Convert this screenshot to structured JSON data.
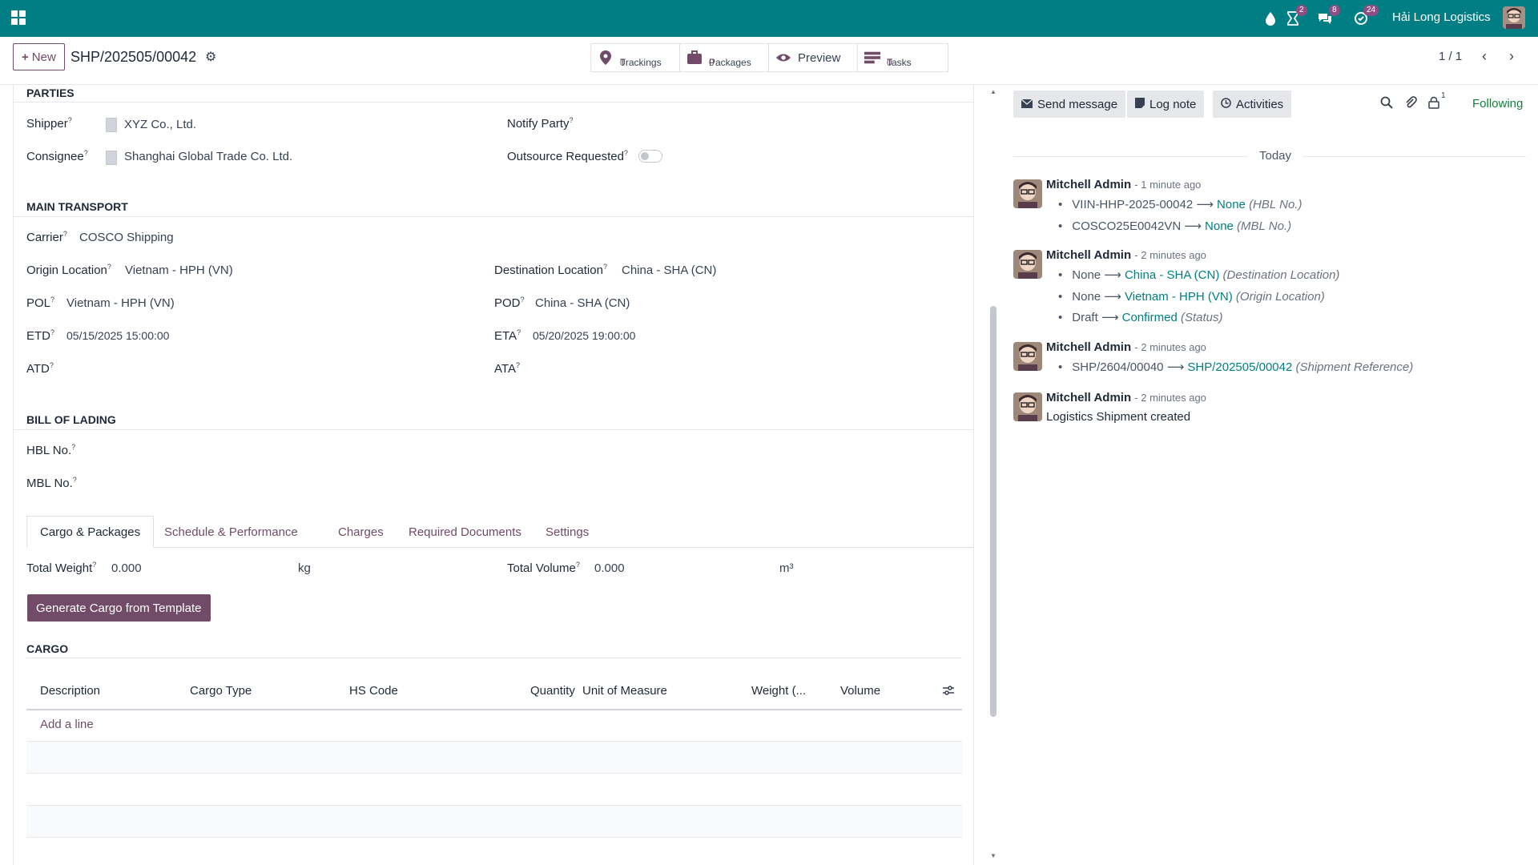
{
  "topbar": {
    "company": "Hải Long Logistics",
    "badges": {
      "activities": "2",
      "messages": "8",
      "tasks": "24"
    }
  },
  "controls": {
    "new_label": "New",
    "record": "SHP/202505/00042",
    "smart_buttons": [
      {
        "label": "Trackings",
        "value": "0"
      },
      {
        "label": "Packages",
        "value": "0"
      },
      {
        "label": "Preview",
        "value": ""
      },
      {
        "label": "Tasks",
        "value": "0"
      }
    ],
    "pager": "1 / 1"
  },
  "parties": {
    "title": "PARTIES",
    "shipper_label": "Shipper",
    "shipper": "XYZ Co., Ltd.",
    "consignee_label": "Consignee",
    "consignee": "Shanghai Global Trade Co. Ltd.",
    "notify_label": "Notify Party",
    "outsource_label": "Outsource Requested"
  },
  "transport": {
    "title": "MAIN TRANSPORT",
    "carrier_label": "Carrier",
    "carrier": "COSCO Shipping",
    "origin_label": "Origin Location",
    "origin": "Vietnam - HPH (VN)",
    "dest_label": "Destination Location",
    "dest": "China - SHA (CN)",
    "pol_label": "POL",
    "pol": "Vietnam - HPH (VN)",
    "pod_label": "POD",
    "pod": "China - SHA (CN)",
    "etd_label": "ETD",
    "etd": "05/15/2025 15:00:00",
    "eta_label": "ETA",
    "eta": "05/20/2025 19:00:00",
    "atd_label": "ATD",
    "ata_label": "ATA"
  },
  "bol": {
    "title": "BILL OF LADING",
    "hbl_label": "HBL No.",
    "mbl_label": "MBL No."
  },
  "tabs": [
    "Cargo & Packages",
    "Schedule & Performance",
    "Charges",
    "Required Documents",
    "Settings"
  ],
  "cargo": {
    "total_weight_label": "Total Weight",
    "total_weight": "0.000",
    "weight_unit": "kg",
    "total_volume_label": "Total Volume",
    "total_volume": "0.000",
    "volume_unit": "m³",
    "generate_btn": "Generate Cargo from Template",
    "title": "CARGO",
    "columns": [
      "Description",
      "Cargo Type",
      "HS Code",
      "Quantity",
      "Unit of Measure",
      "Weight (...",
      "Volume"
    ],
    "add_line": "Add a line"
  },
  "chatter": {
    "send_message": "Send message",
    "log_note": "Log note",
    "activities": "Activities",
    "followers_count": "1",
    "following": "Following",
    "today": "Today",
    "messages": [
      {
        "author": "Mitchell Admin",
        "time": "- 1 minute ago",
        "changes": [
          {
            "old": "VIIN-HHP-2025-00042",
            "new": "None",
            "field": "(HBL No.)"
          },
          {
            "old": "COSCO25E0042VN",
            "new": "None",
            "field": "(MBL No.)"
          }
        ]
      },
      {
        "author": "Mitchell Admin",
        "time": "- 2 minutes ago",
        "changes": [
          {
            "old": "None",
            "new": "China - SHA (CN)",
            "field": "(Destination Location)"
          },
          {
            "old": "None",
            "new": "Vietnam - HPH (VN)",
            "field": "(Origin Location)"
          },
          {
            "old": "Draft",
            "new": "Confirmed",
            "field": "(Status)"
          }
        ]
      },
      {
        "author": "Mitchell Admin",
        "time": "- 2 minutes ago",
        "changes": [
          {
            "old": "SHP/2604/00040",
            "new": "SHP/202505/00042",
            "field": "(Shipment Reference)"
          }
        ]
      },
      {
        "author": "Mitchell Admin",
        "time": "- 2 minutes ago",
        "text": "Logistics Shipment created"
      }
    ]
  }
}
